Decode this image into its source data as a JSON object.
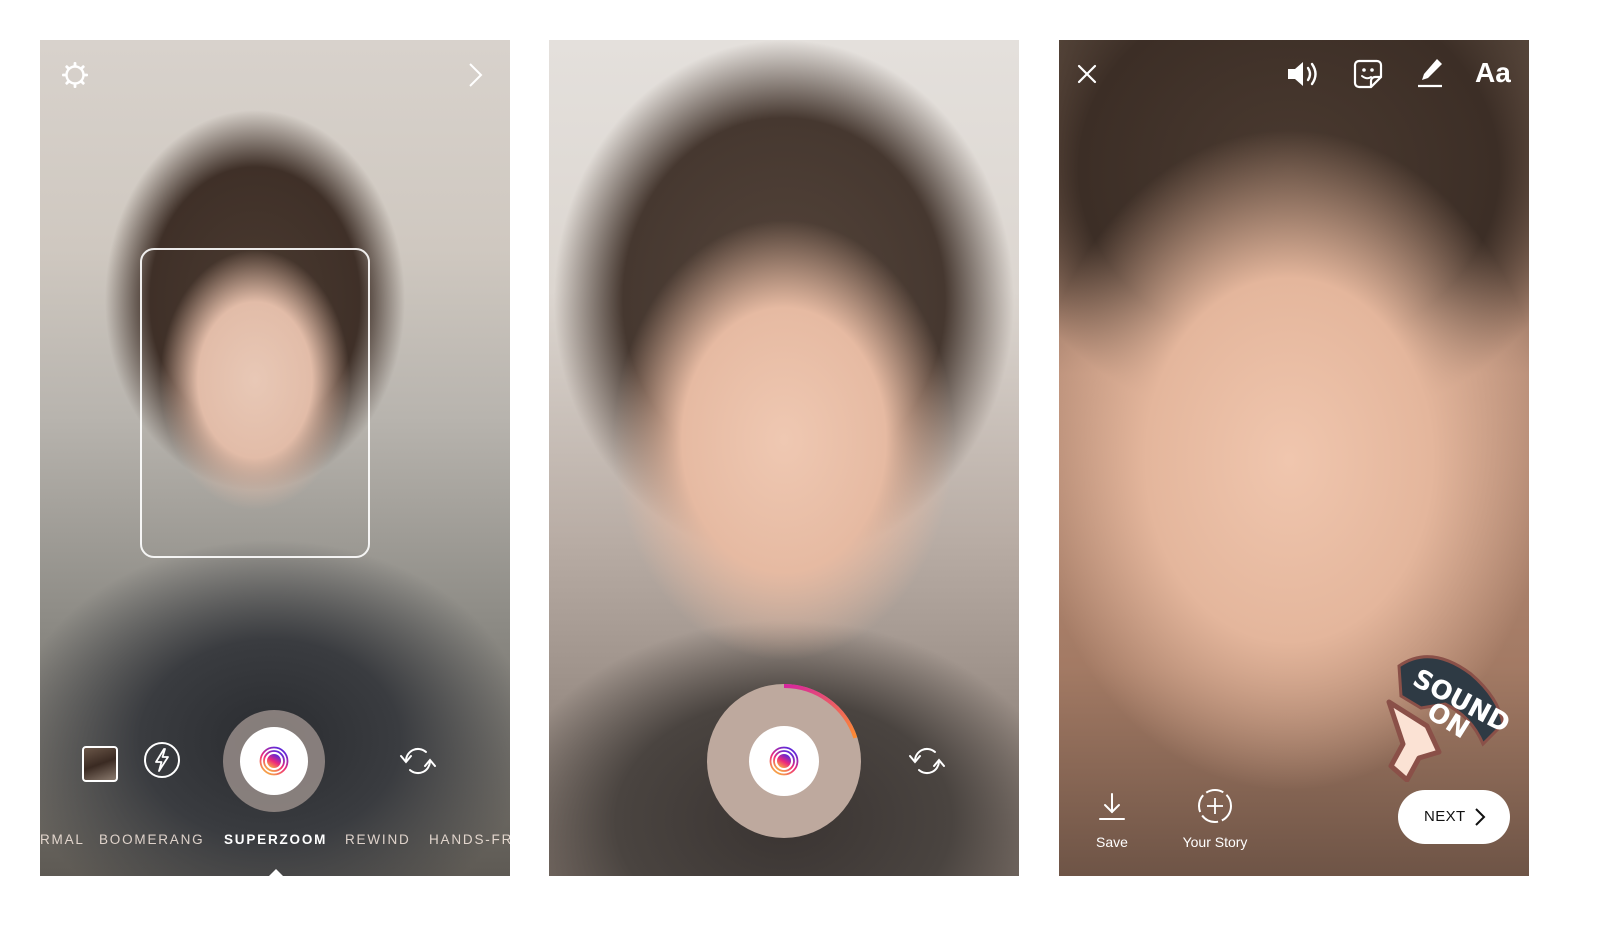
{
  "panels": [
    {
      "id": "capture",
      "top_bar": {
        "left_icon": "settings-icon",
        "right_icon": "chevron-right-icon"
      },
      "face_detection_box": true,
      "controls": {
        "gallery_icon": "gallery-thumbnail",
        "flash_icon": "flash-icon",
        "shutter_icon": "superzoom-shutter-icon",
        "flip_icon": "flip-camera-icon"
      },
      "modes": [
        "RMAL",
        "BOOMERANG",
        "SUPERZOOM",
        "REWIND",
        "HANDS-FR"
      ],
      "active_mode": "SUPERZOOM"
    },
    {
      "id": "recording",
      "recording_progress": 0.2,
      "controls": {
        "shutter_icon": "superzoom-shutter-icon",
        "flip_icon": "flip-camera-icon"
      }
    },
    {
      "id": "edit",
      "top_bar": {
        "close_icon": "close-icon",
        "sound_icon": "speaker-icon",
        "sticker_icon": "sticker-icon",
        "draw_icon": "pen-icon",
        "text_tool_label": "Aa"
      },
      "sticker": {
        "line1": "SOUND",
        "line2": "ON"
      },
      "bottom_bar": {
        "save_label": "Save",
        "story_label": "Your Story",
        "next_label": "NEXT"
      }
    }
  ],
  "colors": {
    "gradient_start": "#f9ce34",
    "gradient_mid": "#ee2a7b",
    "gradient_end": "#6228d7",
    "progress_start": "#d6249f",
    "progress_end": "#fd8d32"
  }
}
